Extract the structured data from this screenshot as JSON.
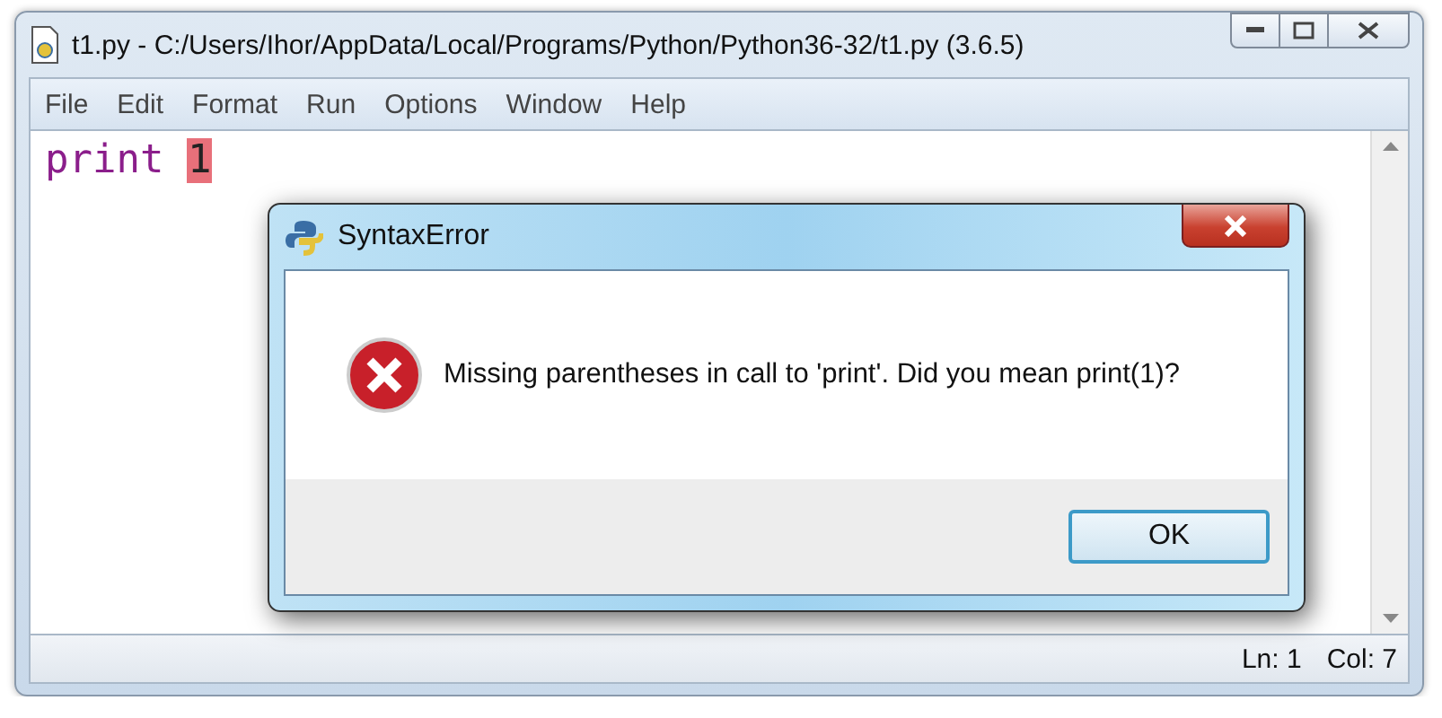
{
  "window": {
    "title": "t1.py - C:/Users/Ihor/AppData/Local/Programs/Python/Python36-32/t1.py (3.6.5)"
  },
  "menu": [
    "File",
    "Edit",
    "Format",
    "Run",
    "Options",
    "Window",
    "Help"
  ],
  "editor": {
    "tokens": [
      {
        "text": "print",
        "kind": "keyword"
      },
      {
        "text": "1",
        "kind": "error"
      }
    ]
  },
  "dialog": {
    "title": "SyntaxError",
    "message": "Missing parentheses in call to 'print'. Did you mean print(1)?",
    "button": "OK"
  },
  "status_bar": {
    "line": "Ln: 1",
    "column": "Col: 7"
  }
}
